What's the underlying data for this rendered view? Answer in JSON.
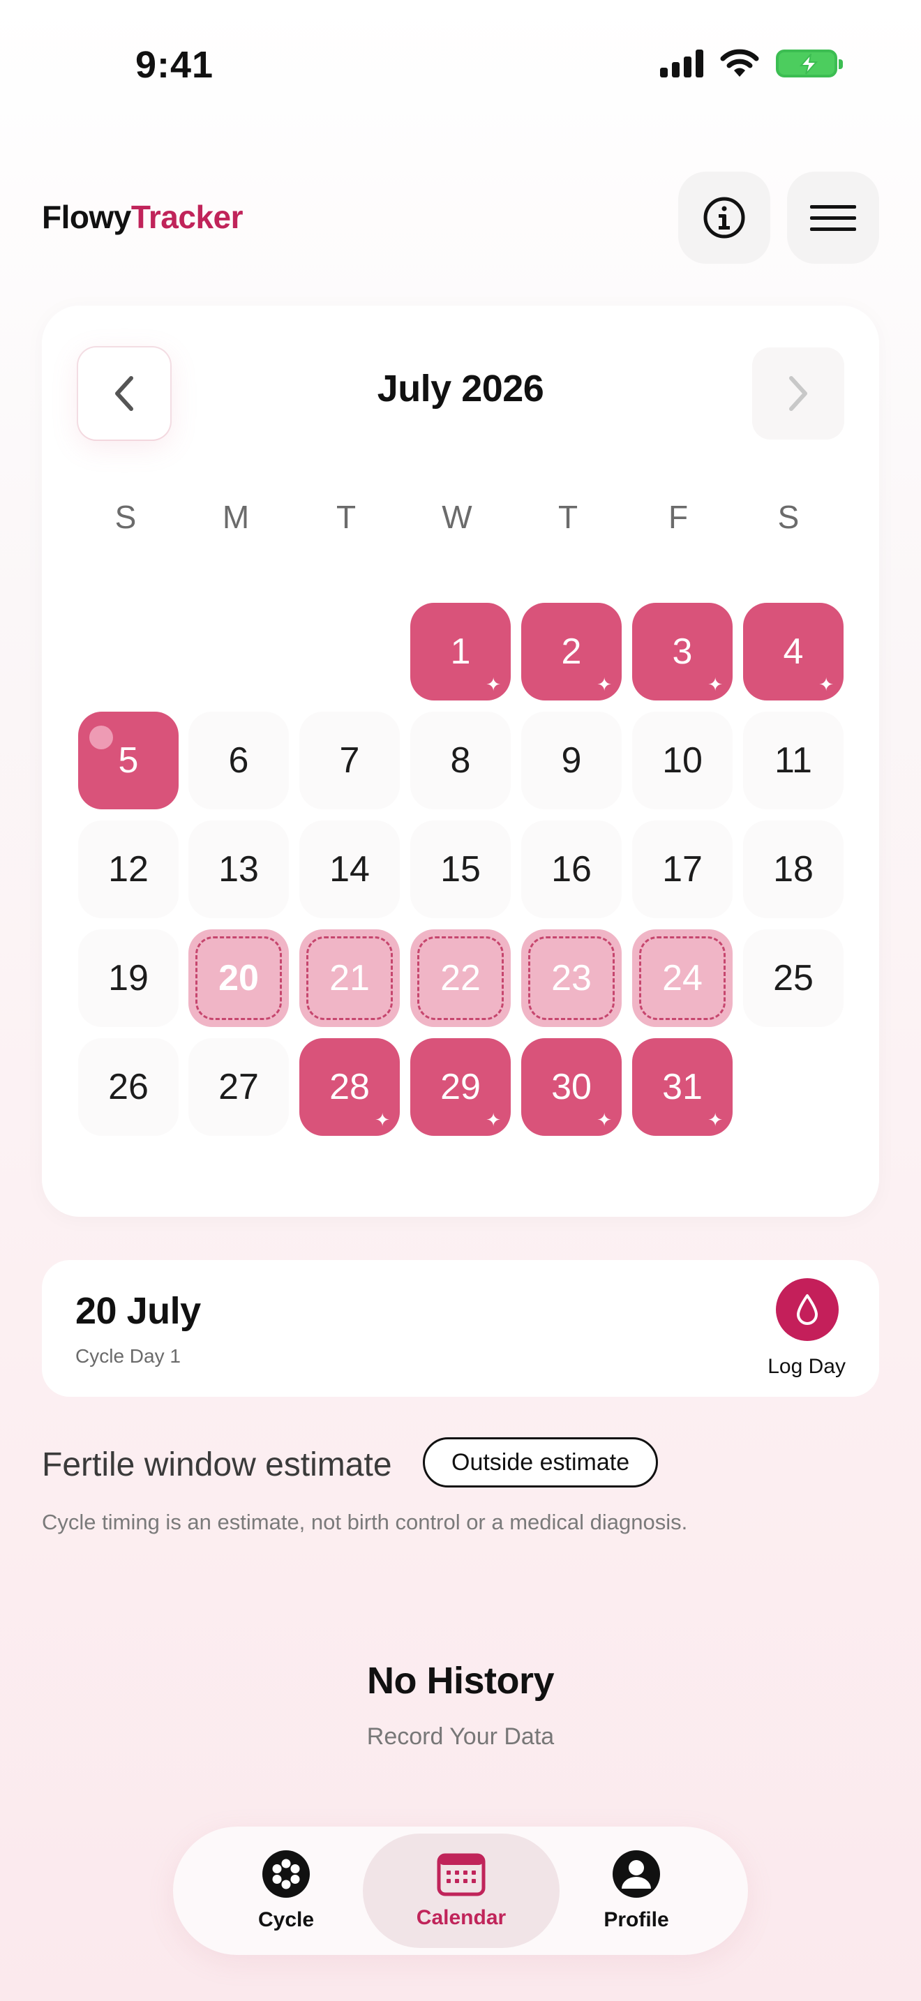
{
  "status_bar": {
    "time": "9:41"
  },
  "header": {
    "brand_part1": "Flowy",
    "brand_part2": "Tracker"
  },
  "calendar": {
    "month_label": "July 2026",
    "weekdays": [
      "S",
      "M",
      "T",
      "W",
      "T",
      "F",
      "S"
    ],
    "days": [
      "1",
      "2",
      "3",
      "4",
      "5",
      "6",
      "7",
      "8",
      "9",
      "10",
      "11",
      "12",
      "13",
      "14",
      "15",
      "16",
      "17",
      "18",
      "19",
      "20",
      "21",
      "22",
      "23",
      "24",
      "25",
      "26",
      "27",
      "28",
      "29",
      "30",
      "31"
    ],
    "spark_glyph": "✦"
  },
  "selected_day": {
    "date": "20 July",
    "cycle_day": "Cycle Day 1",
    "log_label": "Log Day"
  },
  "fertile": {
    "label": "Fertile window estimate",
    "status": "Outside estimate",
    "disclaimer": "Cycle timing is an estimate, not birth control or a medical diagnosis."
  },
  "history": {
    "title": "No History",
    "subtitle": "Record Your Data"
  },
  "tabs": [
    {
      "label": "Cycle"
    },
    {
      "label": "Calendar"
    },
    {
      "label": "Profile"
    }
  ],
  "colors": {
    "brand": "#c0245a",
    "period": "#d9537a",
    "fertile": "#f0b5c6"
  }
}
